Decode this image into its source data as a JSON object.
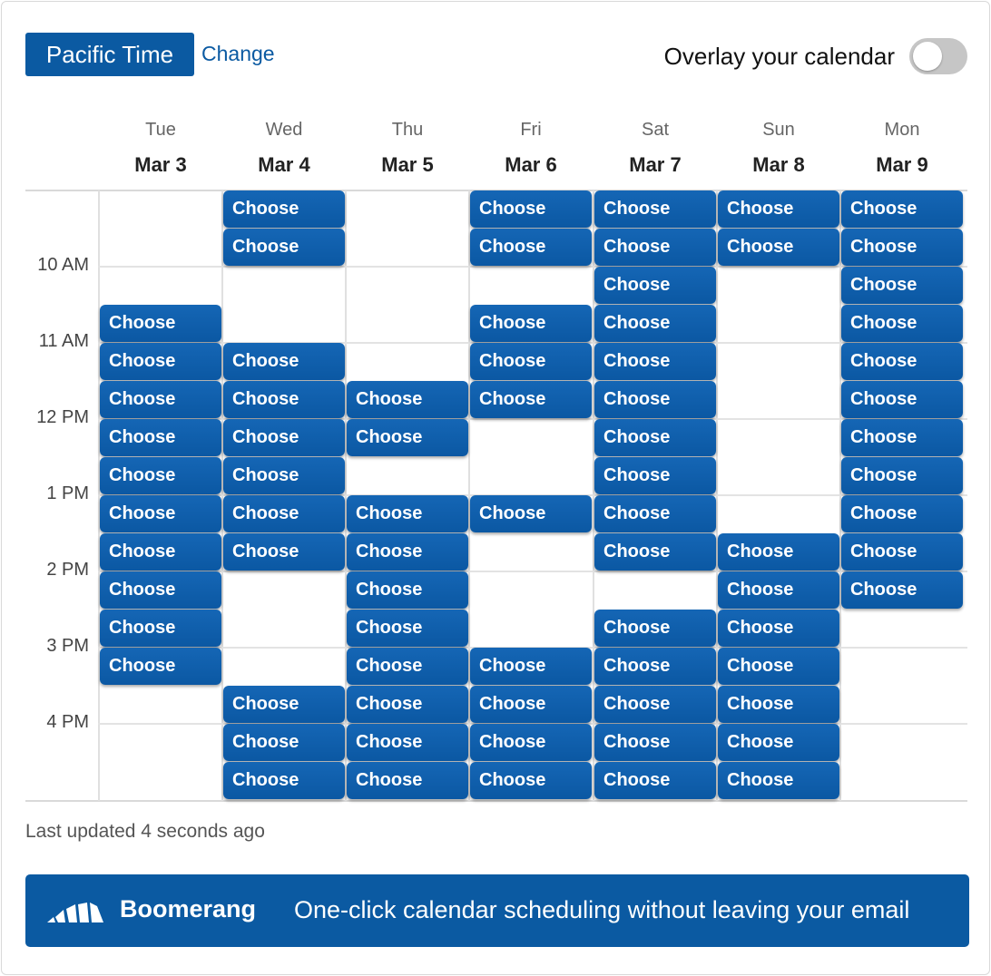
{
  "header": {
    "timezone_label": "Pacific Time",
    "change_label": "Change",
    "overlay_label": "Overlay your calendar",
    "overlay_enabled": false
  },
  "days": [
    {
      "weekday": "Tue",
      "date": "Mar 3"
    },
    {
      "weekday": "Wed",
      "date": "Mar 4"
    },
    {
      "weekday": "Thu",
      "date": "Mar 5"
    },
    {
      "weekday": "Fri",
      "date": "Mar 6"
    },
    {
      "weekday": "Sat",
      "date": "Mar 7"
    },
    {
      "weekday": "Sun",
      "date": "Mar 8"
    },
    {
      "weekday": "Mon",
      "date": "Mar 9"
    }
  ],
  "hours": [
    "10 AM",
    "11 AM",
    "12 PM",
    "1 PM",
    "2 PM",
    "3 PM",
    "4 PM"
  ],
  "slot_label": "Choose",
  "available_slots": [
    [
      3,
      4,
      5,
      6,
      7,
      8,
      9,
      10,
      11,
      12
    ],
    [
      0,
      1,
      4,
      5,
      6,
      7,
      8,
      9,
      13,
      14,
      15
    ],
    [
      5,
      6,
      8,
      9,
      10,
      11,
      12,
      13,
      14,
      15
    ],
    [
      0,
      1,
      3,
      4,
      5,
      8,
      12,
      13,
      14,
      15
    ],
    [
      0,
      1,
      2,
      3,
      4,
      5,
      6,
      7,
      8,
      9,
      11,
      12,
      13,
      14,
      15
    ],
    [
      0,
      1,
      9,
      10,
      11,
      12,
      13,
      14,
      15
    ],
    [
      0,
      1,
      2,
      3,
      4,
      5,
      6,
      7,
      8,
      9,
      10
    ]
  ],
  "footer": {
    "last_updated": "Last updated 4 seconds ago",
    "brand": "Boomerang",
    "tagline": "One-click calendar scheduling without leaving your email"
  },
  "colors": {
    "primary": "#0b5aa2",
    "toggle_off": "#c6c6c6"
  },
  "icons": {
    "logo": "boomerang-logo-icon"
  }
}
